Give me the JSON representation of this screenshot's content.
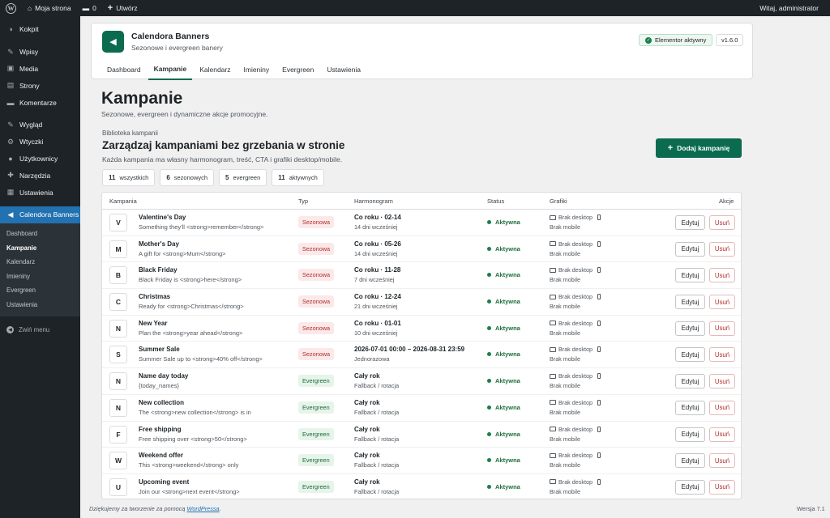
{
  "adminbar": {
    "site_name": "Moja strona",
    "comments_count": "0",
    "new_label": "Utwórz",
    "greeting": "Witaj, administrator"
  },
  "sidebar": {
    "items": [
      {
        "label": "Kokpit",
        "icon": "dashboard-icon",
        "glyph": "◑"
      },
      {
        "label": "Wpisy",
        "icon": "pin-icon",
        "glyph": "✎"
      },
      {
        "label": "Media",
        "icon": "media-icon",
        "glyph": "▣"
      },
      {
        "label": "Strony",
        "icon": "pages-icon",
        "glyph": "▤"
      },
      {
        "label": "Komentarze",
        "icon": "comments-icon",
        "glyph": "▬"
      },
      {
        "label": "Wygląd",
        "icon": "appearance-icon",
        "glyph": "✎"
      },
      {
        "label": "Wtyczki",
        "icon": "plugins-icon",
        "glyph": "⚙"
      },
      {
        "label": "Użytkownicy",
        "icon": "users-icon",
        "glyph": "●"
      },
      {
        "label": "Narzędzia",
        "icon": "tools-icon",
        "glyph": "✚"
      },
      {
        "label": "Ustawienia",
        "icon": "settings-icon",
        "glyph": "▦"
      },
      {
        "label": "Calendora Banners",
        "icon": "megaphone-icon",
        "glyph": "◀"
      }
    ],
    "submenu": [
      "Dashboard",
      "Kampanie",
      "Kalendarz",
      "Imieniny",
      "Evergreen",
      "Ustawienia"
    ],
    "collapse_label": "Zwiń menu"
  },
  "plugin": {
    "name": "Calendora Banners",
    "subtitle": "Sezonowe i evergreen banery",
    "elementor_badge": "Elementor aktywny",
    "version": "v1.6.0",
    "tabs": [
      "Dashboard",
      "Kampanie",
      "Kalendarz",
      "Imieniny",
      "Evergreen",
      "Ustawienia"
    ],
    "active_tab": "Kampanie"
  },
  "page": {
    "title": "Kampanie",
    "subtitle": "Sezonowe, evergreen i dynamiczne akcje promocyjne.",
    "eyebrow": "Biblioteka kampanii",
    "section_title": "Zarządzaj kampaniami bez grzebania w stronie",
    "section_desc": "Każda kampania ma własny harmonogram, treść, CTA i grafiki desktop/mobile.",
    "add_button": "Dodaj kampanię"
  },
  "filters": [
    {
      "count": "11",
      "label": "wszystkich"
    },
    {
      "count": "6",
      "label": "sezonowych"
    },
    {
      "count": "5",
      "label": "evergreen"
    },
    {
      "count": "11",
      "label": "aktywnych"
    }
  ],
  "table": {
    "headers": {
      "campaign": "Kampania",
      "type": "Typ",
      "schedule": "Harmonogram",
      "status": "Status",
      "graphics": "Grafiki",
      "actions": "Akcje"
    },
    "edit_label": "Edytuj",
    "delete_label": "Usuń",
    "no_desktop": "Brak desktop",
    "no_mobile": "Brak mobile",
    "rows": [
      {
        "letter": "V",
        "name": "Valentine's Day",
        "desc": "Something they'll <strong>remember</strong>",
        "type": "Sezonowa",
        "kind": "seasonal",
        "schedule": "Co roku · 02-14",
        "schedule_sub": "14 dni wcześniej",
        "status": "Aktywna"
      },
      {
        "letter": "M",
        "name": "Mother's Day",
        "desc": "A gift for <strong>Mum</strong>",
        "type": "Sezonowa",
        "kind": "seasonal",
        "schedule": "Co roku · 05-26",
        "schedule_sub": "14 dni wcześniej",
        "status": "Aktywna"
      },
      {
        "letter": "B",
        "name": "Black Friday",
        "desc": "Black Friday is <strong>here</strong>",
        "type": "Sezonowa",
        "kind": "seasonal",
        "schedule": "Co roku · 11-28",
        "schedule_sub": "7 dni wcześniej",
        "status": "Aktywna"
      },
      {
        "letter": "C",
        "name": "Christmas",
        "desc": "Ready for <strong>Christmas</strong>",
        "type": "Sezonowa",
        "kind": "seasonal",
        "schedule": "Co roku · 12-24",
        "schedule_sub": "21 dni wcześniej",
        "status": "Aktywna"
      },
      {
        "letter": "N",
        "name": "New Year",
        "desc": "Plan the <strong>year ahead</strong>",
        "type": "Sezonowa",
        "kind": "seasonal",
        "schedule": "Co roku · 01-01",
        "schedule_sub": "10 dni wcześniej",
        "status": "Aktywna"
      },
      {
        "letter": "S",
        "name": "Summer Sale",
        "desc": "Summer Sale up to <strong>40% off</strong>",
        "type": "Sezonowa",
        "kind": "seasonal",
        "schedule": "2026-07-01 00:00 – 2026-08-31 23:59",
        "schedule_sub": "Jednorazowa",
        "status": "Aktywna"
      },
      {
        "letter": "N",
        "name": "Name day today",
        "desc": "{today_names}",
        "type": "Evergreen",
        "kind": "evergreen",
        "schedule": "Cały rok",
        "schedule_sub": "Fallback / rotacja",
        "status": "Aktywna"
      },
      {
        "letter": "N",
        "name": "New collection",
        "desc": "The <strong>new collection</strong> is in",
        "type": "Evergreen",
        "kind": "evergreen",
        "schedule": "Cały rok",
        "schedule_sub": "Fallback / rotacja",
        "status": "Aktywna"
      },
      {
        "letter": "F",
        "name": "Free shipping",
        "desc": "Free shipping over <strong>50</strong>",
        "type": "Evergreen",
        "kind": "evergreen",
        "schedule": "Cały rok",
        "schedule_sub": "Fallback / rotacja",
        "status": "Aktywna"
      },
      {
        "letter": "W",
        "name": "Weekend offer",
        "desc": "This <strong>weekend</strong> only",
        "type": "Evergreen",
        "kind": "evergreen",
        "schedule": "Cały rok",
        "schedule_sub": "Fallback / rotacja",
        "status": "Aktywna"
      },
      {
        "letter": "U",
        "name": "Upcoming event",
        "desc": "Join our <strong>next event</strong>",
        "type": "Evergreen",
        "kind": "evergreen",
        "schedule": "Cały rok",
        "schedule_sub": "Fallback / rotacja",
        "status": "Aktywna"
      }
    ]
  },
  "footer": {
    "thanks_prefix": "Dziękujemy za tworzenie za pomocą",
    "wordpress_link": "WordPressa",
    "thanks_suffix": ".",
    "version": "Wersja 7.1"
  },
  "colors": {
    "brand": "#0b6b4e",
    "admin_dark": "#1d2327",
    "wp_blue": "#2271b1",
    "seasonal_badge_bg": "#fbe9e9",
    "evergreen_badge_bg": "#e6f4ea"
  }
}
